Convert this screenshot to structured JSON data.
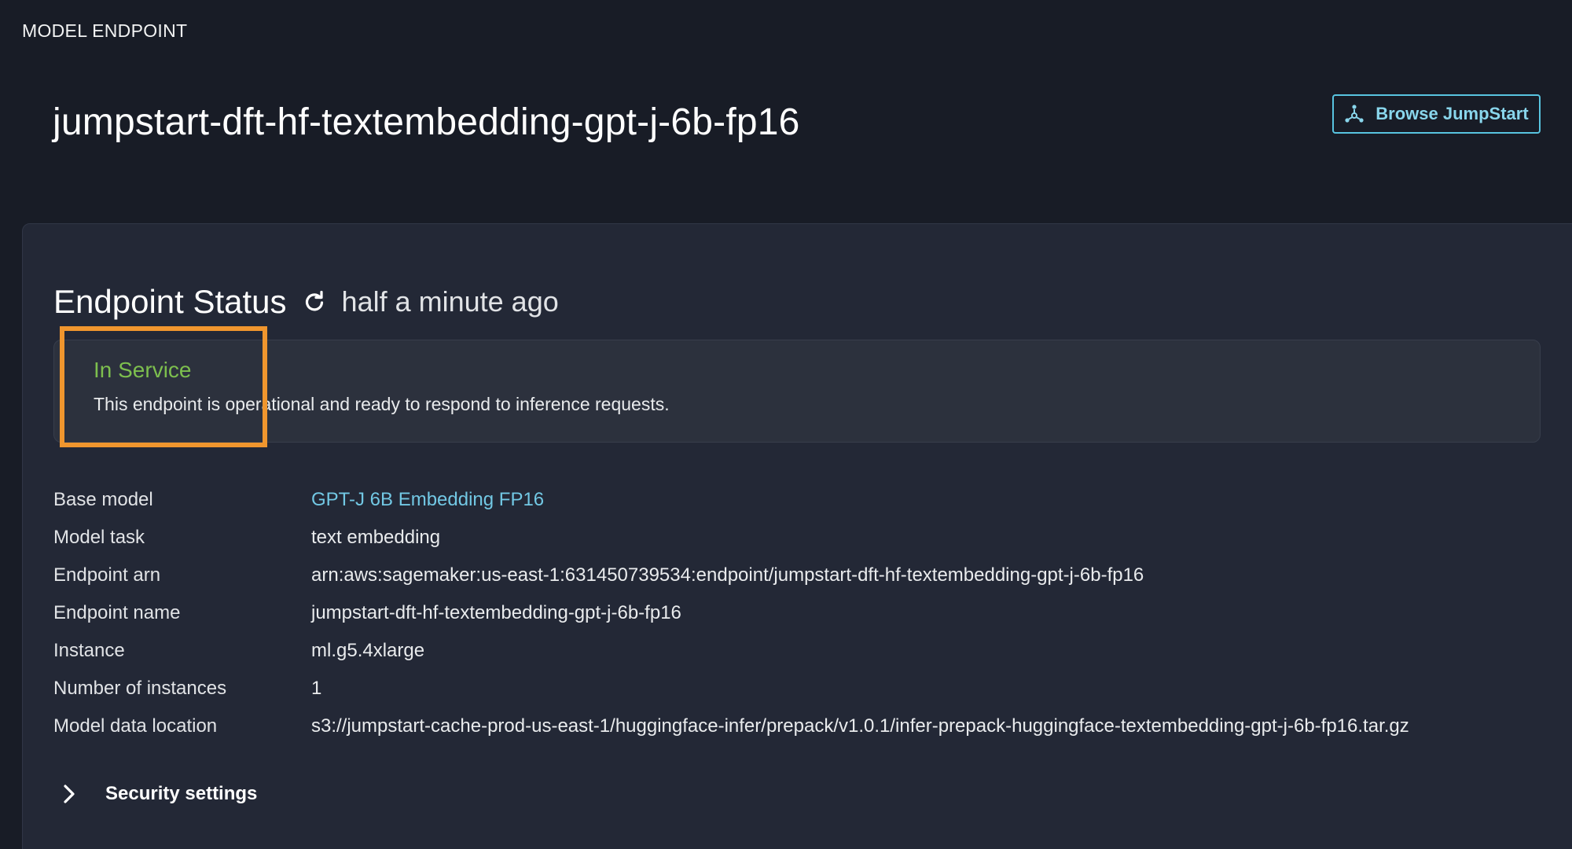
{
  "header": {
    "section_label": "MODEL ENDPOINT",
    "title": "jumpstart-dft-hf-textembedding-gpt-j-6b-fp16",
    "browse_button": {
      "label": "Browse JumpStart",
      "icon": "jumpstart-icon"
    }
  },
  "status": {
    "heading": "Endpoint Status",
    "refresh_icon": "refresh-icon",
    "updated": "half a minute ago",
    "state": "In Service",
    "description": "This endpoint is operational and ready to respond to inference requests.",
    "highlight_color": "#f0962e"
  },
  "details": [
    {
      "label": "Base model",
      "value": "GPT-J 6B Embedding FP16",
      "link": true
    },
    {
      "label": "Model task",
      "value": "text embedding"
    },
    {
      "label": "Endpoint arn",
      "value": "arn:aws:sagemaker:us-east-1:631450739534:endpoint/jumpstart-dft-hf-textembedding-gpt-j-6b-fp16"
    },
    {
      "label": "Endpoint name",
      "value": "jumpstart-dft-hf-textembedding-gpt-j-6b-fp16"
    },
    {
      "label": "Instance",
      "value": "ml.g5.4xlarge"
    },
    {
      "label": "Number of instances",
      "value": "1"
    },
    {
      "label": "Model data location",
      "value": "s3://jumpstart-cache-prod-us-east-1/huggingface-infer/prepack/v1.0.1/infer-prepack-huggingface-textembedding-gpt-j-6b-fp16.tar.gz"
    }
  ],
  "security": {
    "label": "Security settings",
    "icon": "chevron-right-icon",
    "expanded": false
  },
  "colors": {
    "background": "#181c26",
    "panel": "#232836",
    "status_green": "#7dbf4e",
    "link": "#72c8e4",
    "button_border": "#58c4e0"
  }
}
